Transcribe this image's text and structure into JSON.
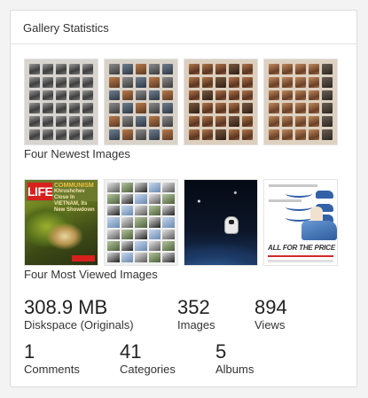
{
  "card": {
    "title": "Gallery Statistics"
  },
  "newest": {
    "caption": "Four Newest Images",
    "images": [
      {
        "name": "contact-sheet-bw"
      },
      {
        "name": "contact-sheet-mixed"
      },
      {
        "name": "contact-sheet-warm"
      },
      {
        "name": "contact-sheet-warm-2"
      }
    ]
  },
  "most_viewed": {
    "caption": "Four Most Viewed Images",
    "life_cover": {
      "logo": "LIFE",
      "headline_1": "COMMUNISM",
      "headline_2": "Khrushchev Close In",
      "headline_3": "VIETNAM, Its New Showdown"
    },
    "ad": {
      "tagline": "ALL FOR THE PRICE OF"
    }
  },
  "stats": {
    "diskspace": {
      "value": "308.9 MB",
      "label": "Diskspace (Originals)"
    },
    "images": {
      "value": "352",
      "label": "Images"
    },
    "views": {
      "value": "894",
      "label": "Views"
    },
    "comments": {
      "value": "1",
      "label": "Comments"
    },
    "categories": {
      "value": "41",
      "label": "Categories"
    },
    "albums": {
      "value": "5",
      "label": "Albums"
    }
  }
}
